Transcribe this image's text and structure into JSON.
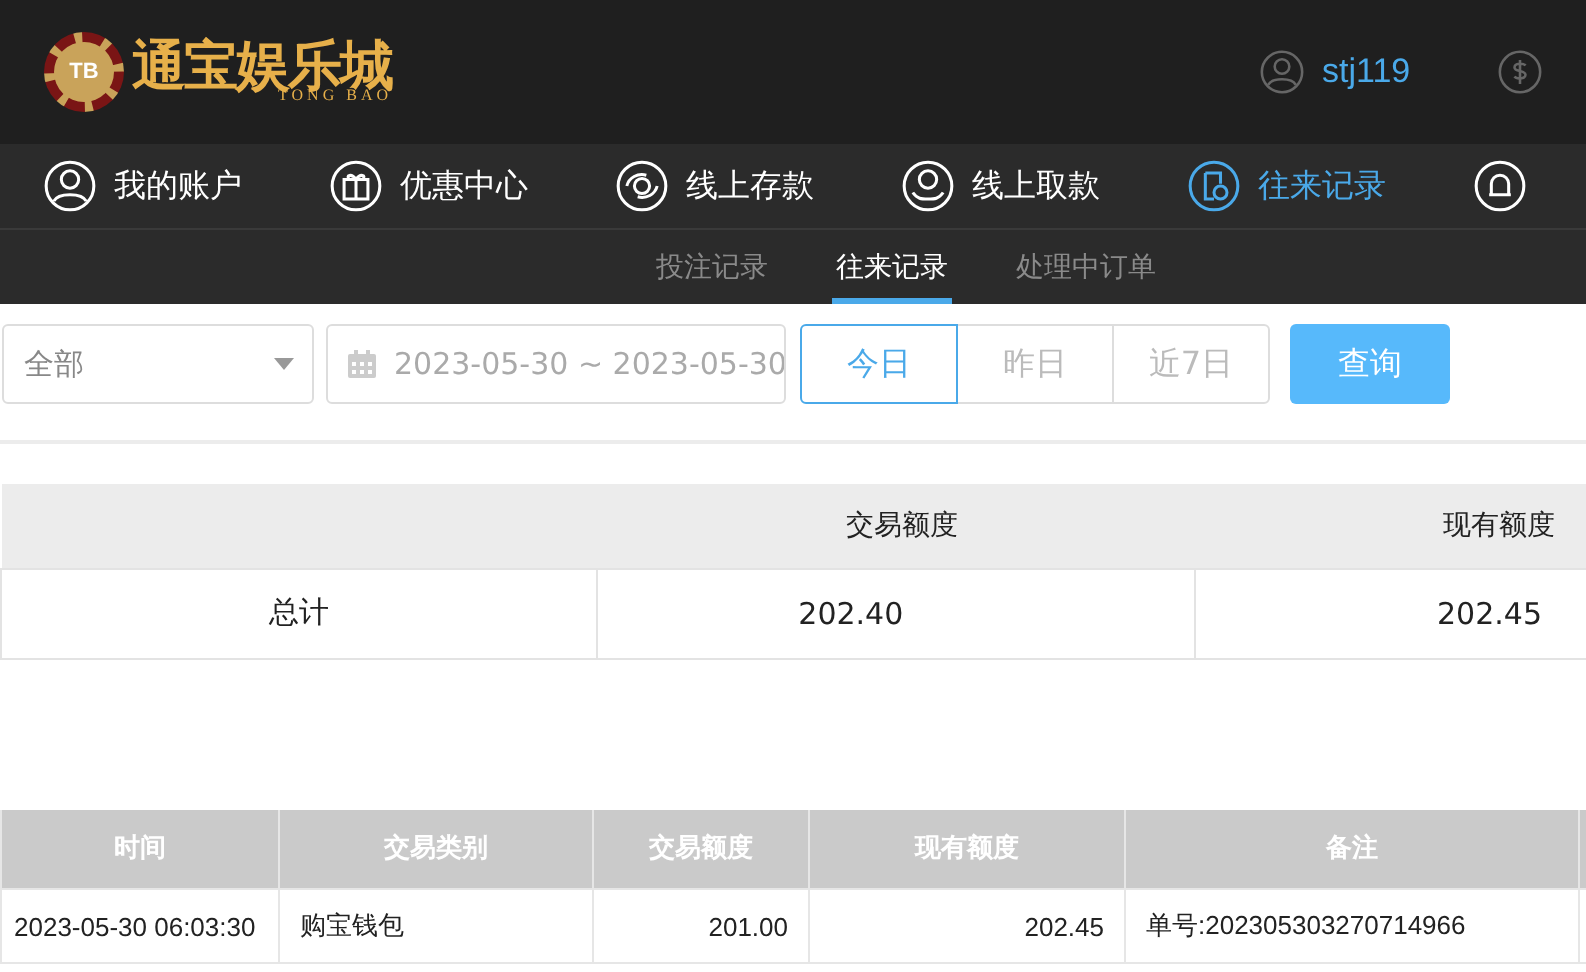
{
  "header": {
    "logo": {
      "badge": "TB",
      "name": "通宝娱乐城",
      "subtitle": "TONG BAO"
    },
    "username": "stj119"
  },
  "nav": [
    {
      "label": "我的账户",
      "selected": false
    },
    {
      "label": "优惠中心",
      "selected": false
    },
    {
      "label": "线上存款",
      "selected": false
    },
    {
      "label": "线上取款",
      "selected": false
    },
    {
      "label": "往来记录",
      "selected": true
    },
    {
      "selected": false
    }
  ],
  "subnav": [
    {
      "label": "投注记录",
      "selected": false
    },
    {
      "label": "往来记录",
      "selected": true
    },
    {
      "label": "处理中订单",
      "selected": false
    }
  ],
  "filters": {
    "type_select": "全部",
    "date_range": "2023-05-30 ~ 2023-05-30",
    "quick_ranges": [
      {
        "label": "今日",
        "selected": true
      },
      {
        "label": "昨日",
        "selected": false
      },
      {
        "label": "近7日",
        "selected": false
      }
    ],
    "query_button": "查询"
  },
  "summary": {
    "columns": [
      "",
      "交易额度",
      "现有额度"
    ],
    "rows": [
      [
        "总计",
        "202.40",
        "202.45"
      ]
    ]
  },
  "table": {
    "columns": [
      "时间",
      "交易类别",
      "交易额度",
      "现有额度",
      "备注",
      ""
    ],
    "rows": [
      [
        "2023-05-30 06:03:30",
        "购宝钱包",
        "201.00",
        "202.45",
        "单号:202305303270714966",
        ""
      ]
    ]
  }
}
